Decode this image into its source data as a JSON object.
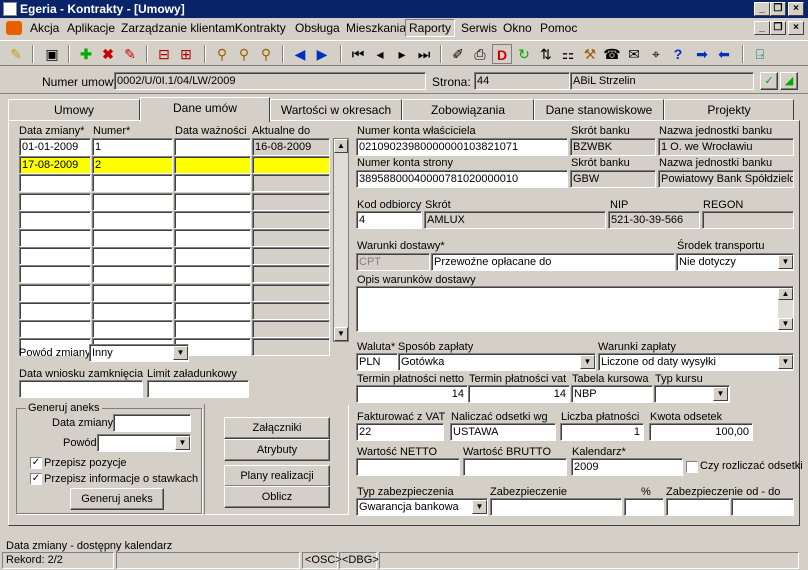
{
  "window": {
    "title": "Egeria - Kontrakty - [Umowy]"
  },
  "menu": [
    "Akcja",
    "Aplikacje",
    "Zarządzanie klientami",
    "Kontrakty",
    "Obsługa",
    "Mieszkania",
    "Raporty",
    "Serwis",
    "Okno",
    "Pomoc"
  ],
  "header": {
    "numer_umowy_label": "Numer umowy:",
    "numer_umowy": "0002/U/0I.1/04/LW/2009",
    "strona_label": "Strona:",
    "strona_kod": "44",
    "strona_nazwa": "ABiL Strzelin"
  },
  "tabs": [
    "Umowy",
    "Dane umów",
    "Wartości  w okresach",
    "Zobowiązania",
    "Dane stanowiskowe",
    "Projekty"
  ],
  "grid": {
    "headers": [
      "Data zmiany*",
      "Numer*",
      "Data ważności",
      "Aktualne do"
    ],
    "rows": [
      [
        "01-01-2009",
        "1",
        "",
        "16-08-2009"
      ],
      [
        "17-08-2009",
        "2",
        "",
        ""
      ]
    ]
  },
  "left": {
    "powod_zmiany_label": "Powód zmiany",
    "powod_zmiany": "Inny",
    "data_wniosku_label": "Data wniosku zamknięcia",
    "limit_label": "Limit załadunkowy",
    "generuj_aneks_group": "Generuj aneks",
    "data_zmiany_label": "Data zmiany",
    "powod_label": "Powód",
    "przepisz_pozycje": "Przepisz pozycje",
    "przepisz_informacje": "Przepisz informacje o stawkach",
    "generuj_aneks_btn": "Generuj aneks",
    "zalaczniki_btn": "Załączniki",
    "atrybuty_btn": "Atrybuty",
    "plany_btn": "Plany realizacji",
    "oblicz_btn": "Oblicz"
  },
  "right": {
    "numer_konta_wlasciciela_label": "Numer konta właściciela",
    "numer_konta_wlasciciela": "02109023980000000103821071",
    "skrot_banku_label": "Skrót banku",
    "skrot_banku_1": "BZWBK",
    "nazwa_jednostki_label": "Nazwa jednostki banku",
    "nazwa_jednostki_1": "1 O. we Wrocławiu",
    "numer_konta_strony_label": "Numer konta strony",
    "numer_konta_strony": "38958800040000781020000010",
    "skrot_banku_2": "GBW",
    "nazwa_jednostki_2": "Powiatowy Bank Spółdzielc",
    "kod_odbiorcy_label": "Kod odbiorcy",
    "kod_odbiorcy": "4",
    "skrot_label": "Skrót",
    "skrot": "AMLUX",
    "nip_label": "NIP",
    "nip": "521-30-39-566",
    "regon_label": "REGON",
    "regon": "",
    "warunki_dostawy_label": "Warunki dostawy*",
    "warunki_kod": "CPT",
    "warunki_opis": "Przewoźne opłacane do",
    "srodek_transportu_label": "Środek transportu",
    "srodek_transportu": "Nie dotyczy",
    "opis_warunkow_label": "Opis warunków dostawy",
    "waluta_label": "Waluta*",
    "waluta": "PLN",
    "sposob_zaplaty_label": "Sposób zapłaty",
    "sposob_zaplaty": "Gotówka",
    "warunki_zaplaty_label": "Warunki zapłaty",
    "warunki_zaplaty": "Liczone od daty wysyłki",
    "termin_netto_label": "Termin płatności netto",
    "termin_netto": "14",
    "termin_vat_label": "Termin płatności vat",
    "termin_vat": "14",
    "tabela_kursowa_label": "Tabela kursowa",
    "tabela_kursowa": "NBP",
    "typ_kursu_label": "Typ kursu",
    "fakturowac_label": "Fakturować z VAT",
    "fakturowac": "22",
    "odsetki_label": "Naliczać odsetki wg",
    "odsetki": "USTAWA",
    "liczba_platnosci_label": "Liczba płatności",
    "liczba_platnosci": "1",
    "kwota_odsetek_label": "Kwota odsetek",
    "kwota_odsetek": "100,00",
    "wartosc_netto_label": "Wartość NETTO",
    "wartosc_brutto_label": "Wartość BRUTTO",
    "kalendarz_label": "Kalendarz*",
    "kalendarz": "2009",
    "czy_rozliczac": "Czy rozliczać odsetki",
    "typ_zabezpieczenia_label": "Typ zabezpieczenia",
    "typ_zabezpieczenia": "Gwarancja bankowa",
    "zabezpieczenie_label": "Zabezpieczenie",
    "procent_label": "%",
    "zabezpieczenie_od_do_label": "Zabezpieczenie od - do"
  },
  "status": {
    "hint": "Data zmiany - dostępny kalendarz",
    "rekord": "Rekord: 2/2",
    "osc": "<OSC>",
    "dbg": "<DBG>"
  }
}
